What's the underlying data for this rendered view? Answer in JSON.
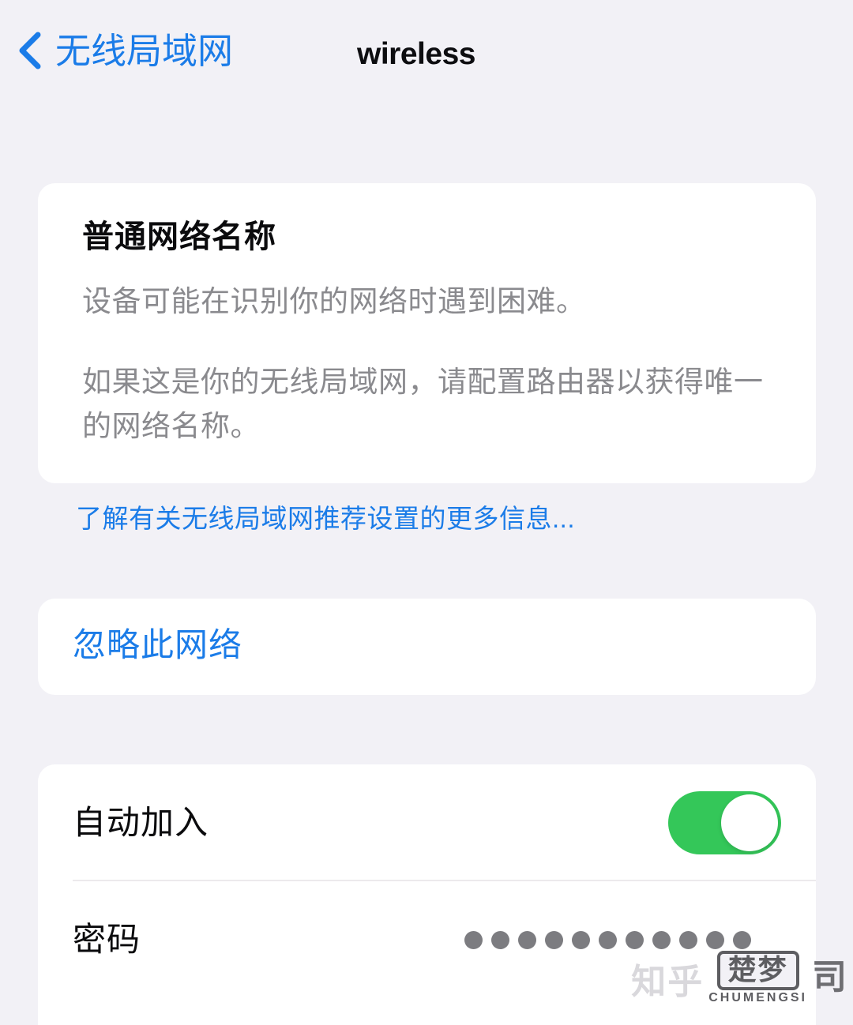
{
  "navbar": {
    "back_label": "无线局域网",
    "back_icon": "chevron-left-icon",
    "title": "wireless"
  },
  "info_card": {
    "title": "普通网络名称",
    "paragraph_1": "设备可能在识别你的网络时遇到困难。",
    "paragraph_2": "如果这是你的无线局域网，请配置路由器以获得唯一的网络名称。"
  },
  "learn_more": {
    "label": "了解有关无线局域网推荐设置的更多信息..."
  },
  "forget_card": {
    "label": "忽略此网络"
  },
  "settings_card": {
    "rows": [
      {
        "label": "自动加入",
        "control": "toggle",
        "value": "on"
      },
      {
        "label": "密码",
        "control": "password",
        "masked_length": 11
      }
    ]
  },
  "watermark": {
    "zhihu": "知乎",
    "badge": "楚梦",
    "badge_sub": "CHUMENGSI",
    "si": "司"
  },
  "colors": {
    "background": "#f2f1f6",
    "card": "#ffffff",
    "accent_blue": "#1b7ce8",
    "toggle_green": "#34c759",
    "text_primary": "#0b0b0d",
    "text_secondary": "#8a8a8e",
    "dot_gray": "#7c7c80"
  }
}
